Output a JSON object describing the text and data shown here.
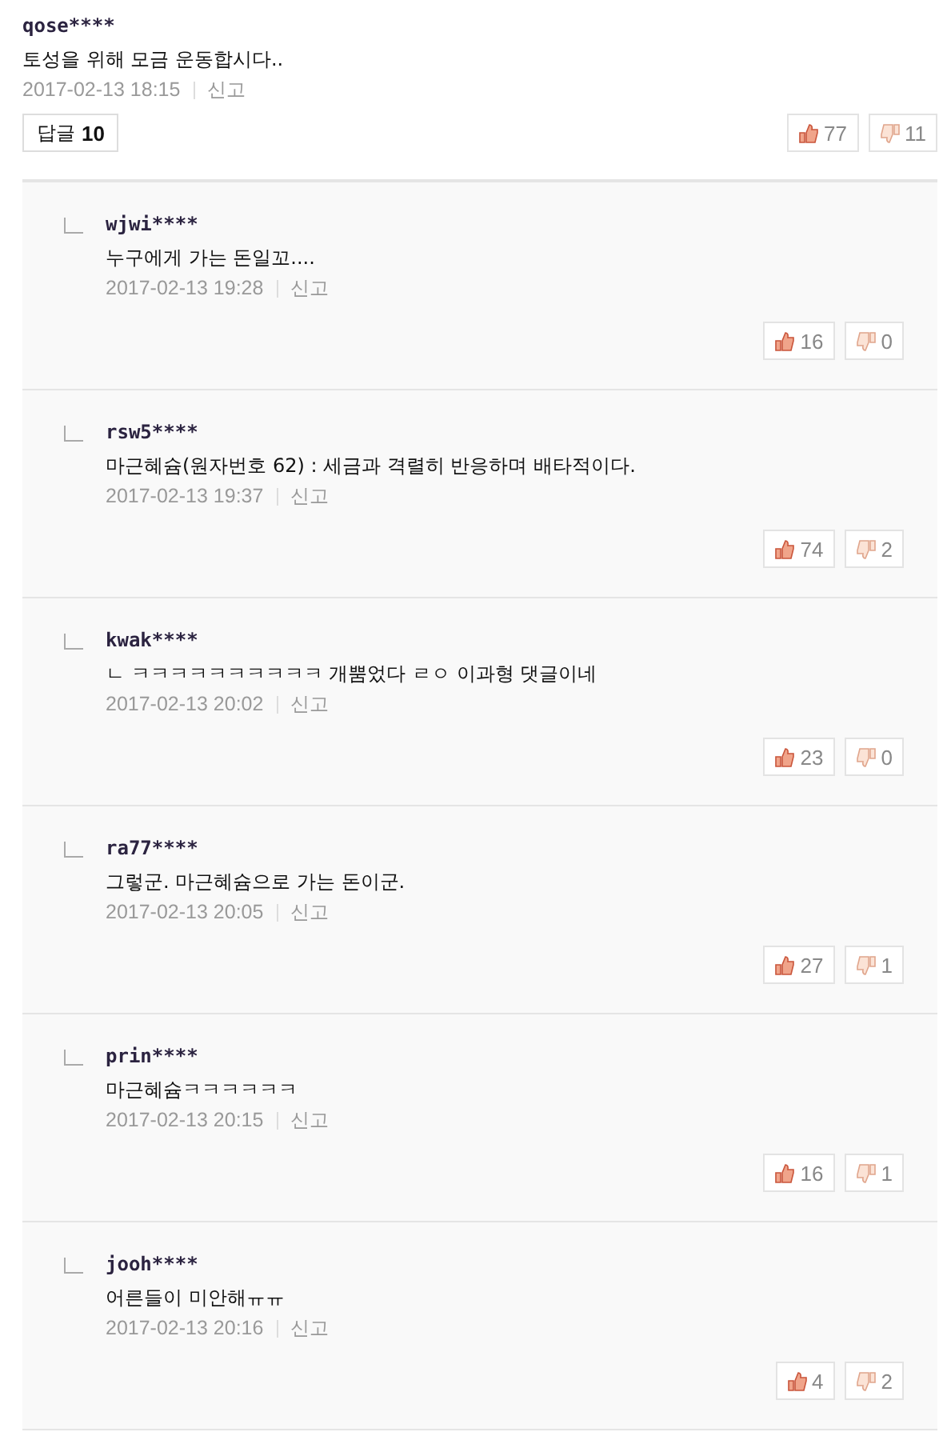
{
  "comment": {
    "username": "qose****",
    "text": "토성을 위해 모금 운동합시다..",
    "date": "2017-02-13 18:15",
    "report": "신고",
    "reply_button": {
      "label": "답글",
      "count": "10"
    },
    "likes": "77",
    "dislikes": "11"
  },
  "replies": [
    {
      "username": "wjwi****",
      "text": "누구에게 가는 돈일꼬....",
      "date": "2017-02-13 19:28",
      "report": "신고",
      "likes": "16",
      "dislikes": "0"
    },
    {
      "username": "rsw5****",
      "text": "마근혜슘(원자번호 62) : 세금과 격렬히 반응하며 배타적이다.",
      "date": "2017-02-13 19:37",
      "report": "신고",
      "likes": "74",
      "dislikes": "2"
    },
    {
      "username": "kwak****",
      "text": "ㄴ ㅋㅋㅋㅋㅋㅋㅋㅋㅋㅋ 개뿜었다 ㄹㅇ 이과형 댓글이네",
      "date": "2017-02-13 20:02",
      "report": "신고",
      "likes": "23",
      "dislikes": "0"
    },
    {
      "username": "ra77****",
      "text": "그렇군. 마근혜슘으로 가는 돈이군.",
      "date": "2017-02-13 20:05",
      "report": "신고",
      "likes": "27",
      "dislikes": "1"
    },
    {
      "username": "prin****",
      "text": "마근혜슘ㅋㅋㅋㅋㅋㅋ",
      "date": "2017-02-13 20:15",
      "report": "신고",
      "likes": "16",
      "dislikes": "1"
    },
    {
      "username": "jooh****",
      "text": "어른들이 미안해ㅠㅠ",
      "date": "2017-02-13 20:16",
      "report": "신고",
      "likes": "4",
      "dislikes": "2"
    }
  ]
}
